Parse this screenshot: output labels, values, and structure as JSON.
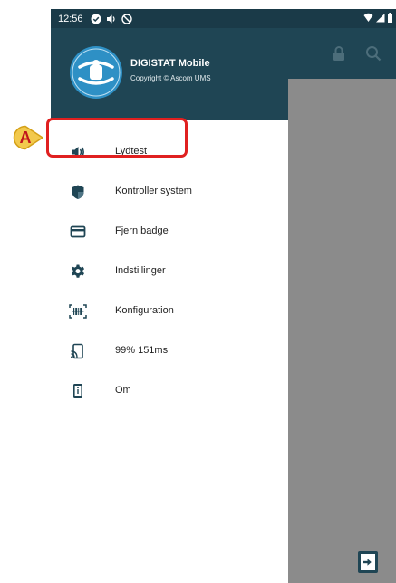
{
  "status_bar": {
    "time": "12:56",
    "left_icons": [
      "check-circle-icon",
      "volume-icon",
      "blocked-icon"
    ],
    "right_icons": [
      "wifi-icon",
      "signal-icon",
      "battery-icon"
    ]
  },
  "drawer": {
    "header": {
      "title": "DIGISTAT Mobile",
      "subtitle": "Copyright © Ascom UMS"
    },
    "items": [
      {
        "label": "Lydtest",
        "icon": "speaker-icon"
      },
      {
        "label": "Kontroller system",
        "icon": "shield-icon"
      },
      {
        "label": "Fjern badge",
        "icon": "badge-card-icon"
      },
      {
        "label": "Indstillinger",
        "icon": "gear-icon"
      },
      {
        "label": "Konfiguration",
        "icon": "barcode-scan-icon"
      },
      {
        "label": "99% 151ms",
        "icon": "cast-signal-icon"
      },
      {
        "label": "Om",
        "icon": "device-info-icon"
      }
    ]
  },
  "annotation": {
    "letter": "A",
    "color": "#e02020",
    "target": "Lydtest"
  },
  "colors": {
    "header": "#1f4554",
    "status_bar": "#1a3a48",
    "icons": "#1f4554",
    "dim_overlay": "#8b8b8b"
  }
}
